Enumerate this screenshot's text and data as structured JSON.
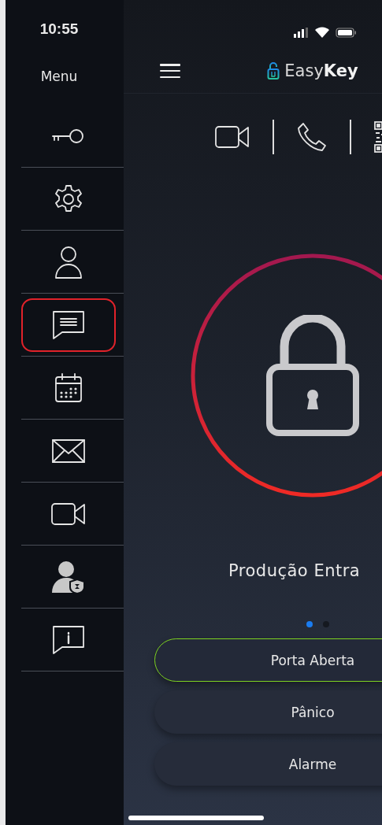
{
  "status_bar": {
    "time": "10:55"
  },
  "menu": {
    "title": "Menu",
    "items": [
      {
        "kind": "key",
        "selected": false
      },
      {
        "kind": "settings",
        "selected": false
      },
      {
        "kind": "user",
        "selected": false
      },
      {
        "kind": "chat",
        "selected": true
      },
      {
        "kind": "calendar",
        "selected": false
      },
      {
        "kind": "mail",
        "selected": false
      },
      {
        "kind": "video",
        "selected": false
      },
      {
        "kind": "user-shield",
        "selected": false
      },
      {
        "kind": "info",
        "selected": false
      }
    ]
  },
  "header": {
    "logo": "Easy**Key**"
  },
  "toolbar": [
    {
      "kind": "video"
    },
    {
      "kind": "phone"
    },
    {
      "kind": "qr"
    }
  ],
  "device": {
    "name": "Produção Entra"
  },
  "pager": [
    {
      "selected": true
    },
    {
      "selected": false
    }
  ],
  "actions": [
    {
      "label": "Porta Aberta",
      "selected": true
    },
    {
      "label": "Pânico",
      "selected": false
    },
    {
      "label": "Alarme",
      "selected": false
    }
  ]
}
